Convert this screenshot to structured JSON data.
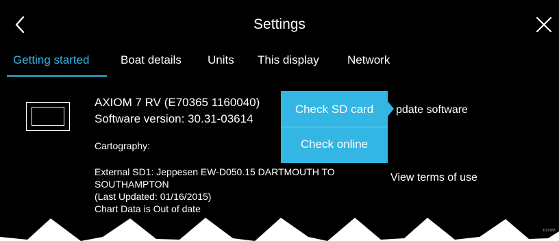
{
  "header": {
    "title": "Settings",
    "back_icon": "chevron-left-icon",
    "close_icon": "close-icon"
  },
  "tabs": [
    {
      "label": "Getting started",
      "active": true
    },
    {
      "label": "Boat details",
      "active": false
    },
    {
      "label": "Units",
      "active": false
    },
    {
      "label": "This display",
      "active": false
    },
    {
      "label": "Network",
      "active": false
    }
  ],
  "device": {
    "icon": "display-device-icon",
    "model": "AXIOM 7 RV (E70365 1160040)",
    "software_version": "Software version: 30.31-03614",
    "cartography_label": "Cartography:",
    "chart_line1": "External SD1:  Jeppesen EW-D050.15 DARTMOUTH TO",
    "chart_line2": "SOUTHAMPTON",
    "chart_line3": "(Last Updated: 01/16/2015)",
    "chart_line4": "Chart Data is Out of date"
  },
  "actions": {
    "update_software": "pdate software",
    "view_terms": "View terms of use"
  },
  "popup": {
    "items": [
      {
        "label": "Check SD card"
      },
      {
        "label": "Check online"
      }
    ]
  },
  "figure_code": "D13787-",
  "colors": {
    "accent": "#34b6e4",
    "background": "#000000",
    "text": "#ffffff"
  }
}
